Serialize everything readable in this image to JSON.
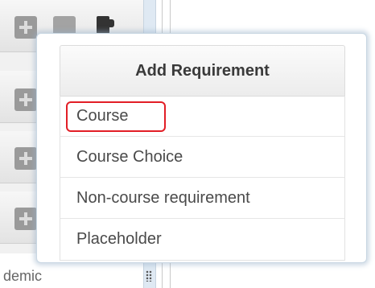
{
  "popup": {
    "title": "Add Requirement",
    "items": [
      {
        "label": "Course",
        "highlighted": true
      },
      {
        "label": "Course Choice",
        "highlighted": false
      },
      {
        "label": "Non-course requirement",
        "highlighted": false
      },
      {
        "label": "Placeholder",
        "highlighted": false
      }
    ]
  },
  "background": {
    "partial_text": "demic"
  },
  "colors": {
    "highlight_border": "#e21e26",
    "popup_glow": "#96afc8",
    "header_text": "#3a3a3a"
  },
  "icons": [
    "plus-icon",
    "minus-icon",
    "document-icon",
    "grip-icon"
  ]
}
